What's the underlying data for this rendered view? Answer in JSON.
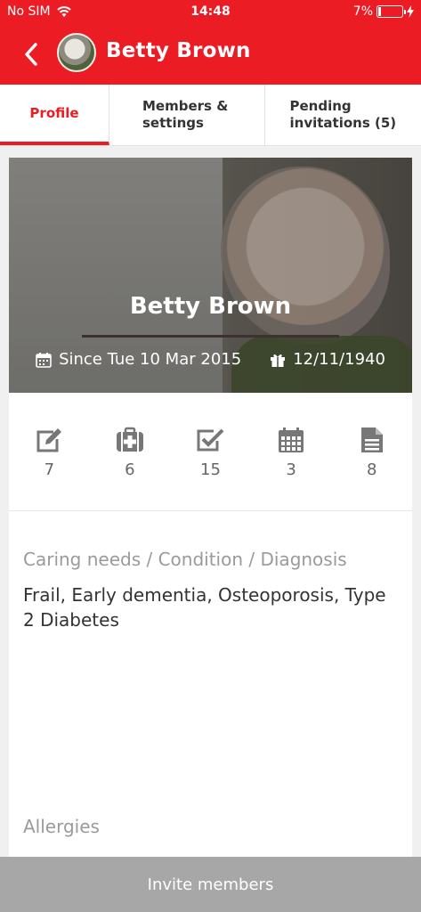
{
  "status_bar": {
    "carrier": "No SIM",
    "time": "14:48",
    "battery": "7%"
  },
  "nav": {
    "title": "Betty Brown"
  },
  "tabs": [
    {
      "label": "Profile"
    },
    {
      "label": "Members & settings"
    },
    {
      "label": "Pending invitations (5)"
    }
  ],
  "hero": {
    "name": "Betty Brown",
    "since": "Since Tue 10 Mar 2015",
    "birthday": "12/11/1940"
  },
  "stats": [
    {
      "icon": "edit-icon",
      "count": "7"
    },
    {
      "icon": "medical-kit-icon",
      "count": "6"
    },
    {
      "icon": "checkbox-icon",
      "count": "15"
    },
    {
      "icon": "calendar-icon",
      "count": "3"
    },
    {
      "icon": "document-icon",
      "count": "8"
    }
  ],
  "caring": {
    "label": "Caring needs / Condition / Diagnosis",
    "text": "Frail, Early dementia, Osteoporosis, Type 2 Diabetes"
  },
  "allergies": {
    "label": "Allergies"
  },
  "invite_button": {
    "label": "Invite members"
  },
  "colors": {
    "brand": "#ec1c24",
    "button": "#a7a7a7"
  }
}
